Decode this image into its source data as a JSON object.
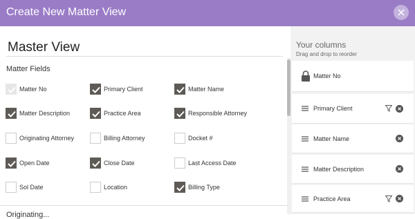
{
  "header": {
    "title": "Create New Matter View"
  },
  "view": {
    "name": "Master View"
  },
  "fields_section": {
    "title": "Matter Fields",
    "fields": [
      {
        "label": "Matter No",
        "state": "disabled"
      },
      {
        "label": "Primary Client",
        "state": "checked"
      },
      {
        "label": "Matter Name",
        "state": "checked"
      },
      {
        "label": "Matter Description",
        "state": "checked"
      },
      {
        "label": "Practice Area",
        "state": "checked"
      },
      {
        "label": "Responsible Attorney",
        "state": "checked"
      },
      {
        "label": "Originating Attorney",
        "state": "unchecked"
      },
      {
        "label": "Billing Attorney",
        "state": "unchecked"
      },
      {
        "label": "Docket #",
        "state": "unchecked"
      },
      {
        "label": "Open Date",
        "state": "checked"
      },
      {
        "label": "Close Date",
        "state": "checked"
      },
      {
        "label": "Last Access Date",
        "state": "unchecked"
      },
      {
        "label": "Sol Date",
        "state": "unchecked"
      },
      {
        "label": "Location",
        "state": "unchecked"
      },
      {
        "label": "Billing Type",
        "state": "checked"
      }
    ]
  },
  "next_section": {
    "title": "Originating..."
  },
  "columns": {
    "title": "Your columns",
    "subtitle": "Drag and drop to reorder",
    "items": [
      {
        "label": "Matter No",
        "locked": true,
        "filter": false,
        "removable": false
      },
      {
        "label": "Primary Client",
        "locked": false,
        "filter": true,
        "removable": true
      },
      {
        "label": "Matter Name",
        "locked": false,
        "filter": false,
        "removable": true
      },
      {
        "label": "Matter Description",
        "locked": false,
        "filter": false,
        "removable": true
      },
      {
        "label": "Practice Area",
        "locked": false,
        "filter": true,
        "removable": true
      }
    ]
  },
  "colors": {
    "header": "#9a7cc6",
    "checkbox_checked": "#5e5a55",
    "panel": "#f2f2f2"
  }
}
